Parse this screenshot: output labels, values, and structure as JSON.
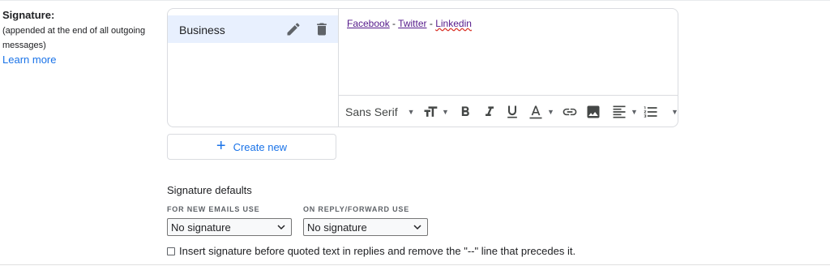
{
  "signature": {
    "title": "Signature:",
    "description": "(appended at the end of all outgoing messages)",
    "learn_more": "Learn more",
    "items": [
      {
        "label": "Business"
      }
    ],
    "editor": {
      "links": [
        "Facebook",
        "Twitter",
        "Linkedin"
      ],
      "separator": "-"
    },
    "toolbar": {
      "font": "Sans Serif",
      "icons": [
        "font-size-icon",
        "bold-icon",
        "italic-icon",
        "underline-icon",
        "text-color-icon",
        "link-icon",
        "image-icon",
        "align-icon",
        "numbered-list-icon",
        "more-options-icon"
      ]
    },
    "create_new": "Create new"
  },
  "defaults": {
    "title": "Signature defaults",
    "new_emails_label": "FOR NEW EMAILS USE",
    "new_emails_value": "No signature",
    "reply_label": "ON REPLY/FORWARD USE",
    "reply_value": "No signature",
    "insert_before_quoted": "Insert signature before quoted text in replies and remove the \"--\" line that precedes it.",
    "insert_before_quoted_checked": false
  },
  "colors": {
    "accent": "#1a73e8",
    "selected_bg": "#e8f0fe",
    "link_visited": "#551a8b",
    "border": "#dadce0"
  }
}
